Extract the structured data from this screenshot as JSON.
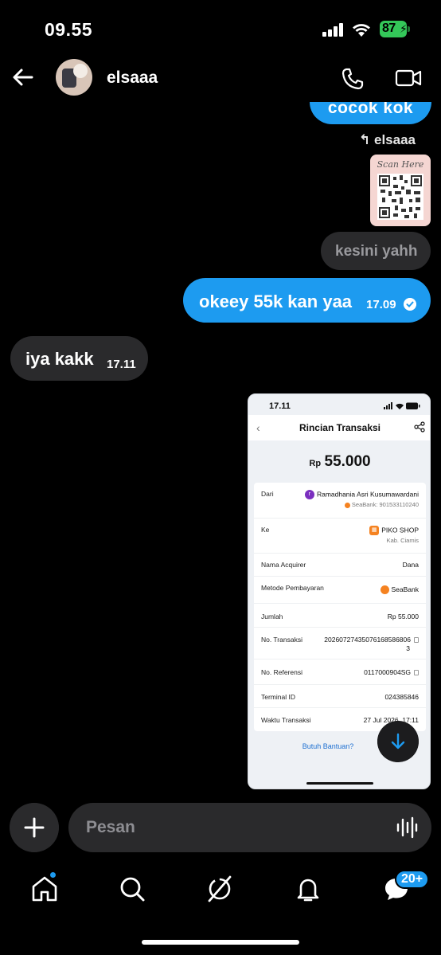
{
  "status_bar": {
    "time": "09.55",
    "battery": "87"
  },
  "header": {
    "contact_name": "elsaaa"
  },
  "messages": {
    "top_partial": "cocok kok",
    "reply_label": "elsaaa",
    "qr_caption": "Scan Here",
    "kesini": "kesini yahh",
    "okey": {
      "text": "okeey 55k kan yaa",
      "time": "17.09"
    },
    "iya": {
      "text": "iya kakk",
      "time": "17.11"
    }
  },
  "receipt": {
    "status_time": "17.11",
    "title": "Rincian Transaksi",
    "currency": "Rp",
    "amount": "55.000",
    "rows": [
      {
        "key": "Dari",
        "value": "Ramadhania Asri Kusumawardani",
        "initial": "r",
        "sub": "SeaBank: 901533110240"
      },
      {
        "key": "Ke",
        "value": "PIKO SHOP",
        "sub": "Kab. Ciamis"
      },
      {
        "key": "Nama Acquirer",
        "value": "Dana"
      },
      {
        "key": "Metode Pembayaran",
        "value": "SeaBank"
      },
      {
        "key": "Jumlah",
        "value": "Rp 55.000"
      },
      {
        "key": "No. Transaksi",
        "value": "20260727435076168586806",
        "value2": "3"
      },
      {
        "key": "No. Referensi",
        "value": "0117000904SG"
      },
      {
        "key": "Terminal ID",
        "value": "024385846"
      },
      {
        "key": "Waktu Transaksi",
        "value": "27 Jul 2026, 17:11"
      }
    ],
    "help": "Butuh Bantuan?"
  },
  "composer": {
    "placeholder": "Pesan"
  },
  "nav": {
    "badge": "20+"
  },
  "colors": {
    "accent": "#1d9bf0",
    "bubble_dark": "#2a2a2c"
  }
}
